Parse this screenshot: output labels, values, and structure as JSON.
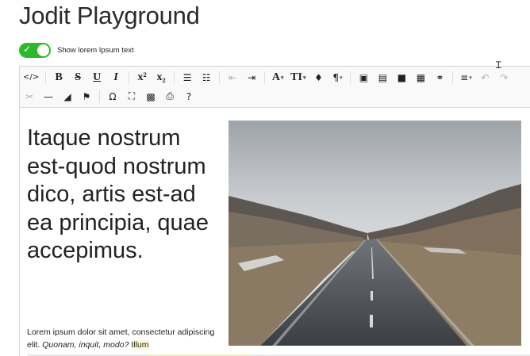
{
  "page": {
    "title": "Jodit Playground"
  },
  "toggle": {
    "label": "Show lorem Ipsum text",
    "on": true,
    "color": "#2eb82e"
  },
  "toolbar": {
    "row1": [
      {
        "name": "source-button",
        "glyph": "</>",
        "cls": "small"
      },
      {
        "sep": true
      },
      {
        "name": "bold-button",
        "glyph": "B",
        "cls": "serif"
      },
      {
        "name": "strikethrough-button",
        "glyph": "S",
        "cls": "serif strike"
      },
      {
        "name": "underline-button",
        "glyph": "U",
        "cls": "serif under"
      },
      {
        "name": "italic-button",
        "glyph": "I",
        "cls": "serif italic"
      },
      {
        "sep": true
      },
      {
        "name": "superscript-button",
        "glyph": "x²",
        "cls": "serif"
      },
      {
        "name": "subscript-button",
        "glyph": "x₂",
        "cls": "serif"
      },
      {
        "sep": true
      },
      {
        "name": "unordered-list-button",
        "glyph": "☰"
      },
      {
        "name": "ordered-list-button",
        "glyph": "☷"
      },
      {
        "sep": true
      },
      {
        "name": "outdent-button",
        "glyph": "⇤",
        "cls": "dis"
      },
      {
        "name": "indent-button",
        "glyph": "⇥"
      },
      {
        "sep": true
      },
      {
        "name": "font-button",
        "glyph": "A",
        "caret": true,
        "cls": "serif"
      },
      {
        "name": "font-size-button",
        "glyph": "TI",
        "caret": true,
        "cls": "serif"
      },
      {
        "name": "brush-button",
        "glyph": "♦"
      },
      {
        "name": "paragraph-button",
        "glyph": "¶",
        "caret": true
      },
      {
        "sep": true
      },
      {
        "name": "image-button",
        "glyph": "▣"
      },
      {
        "name": "file-button",
        "glyph": "▤"
      },
      {
        "name": "video-button",
        "glyph": "■"
      },
      {
        "name": "table-button",
        "glyph": "▦"
      },
      {
        "name": "link-button",
        "glyph": "⚭"
      },
      {
        "sep": true
      },
      {
        "name": "align-button",
        "glyph": "≡",
        "caret": true
      },
      {
        "name": "undo-button",
        "glyph": "↶",
        "cls": "dis"
      },
      {
        "name": "redo-button",
        "glyph": "↷",
        "cls": "dis"
      }
    ],
    "row2": [
      {
        "name": "cut-button",
        "glyph": "✂",
        "cls": "dis"
      },
      {
        "name": "horizontal-rule-button",
        "glyph": "—"
      },
      {
        "name": "eraser-button",
        "glyph": "◢"
      },
      {
        "name": "copy-format-button",
        "glyph": "⚑"
      },
      {
        "sep": true
      },
      {
        "name": "symbol-button",
        "glyph": "Ω"
      },
      {
        "name": "fullsize-button",
        "glyph": "⛶"
      },
      {
        "name": "select-all-button",
        "glyph": "▩"
      },
      {
        "name": "print-button",
        "glyph": "⎙"
      },
      {
        "name": "about-button",
        "glyph": "?"
      }
    ]
  },
  "content": {
    "heading": "Itaque nostrum est-quod nostrum dico, artis est-ad ea principia, quae accepimus.",
    "paragraph_start": "Lorem ipsum dolor sit amet, consectetur adipiscing elit.",
    "paragraph_em": "Quonam, inquit, modo?",
    "paragraph_hl": "Illum"
  },
  "colors": {
    "accent": "#2eb82e",
    "highlight": "#fdf7d6",
    "toolbar_bg": "#f9f9f9"
  }
}
